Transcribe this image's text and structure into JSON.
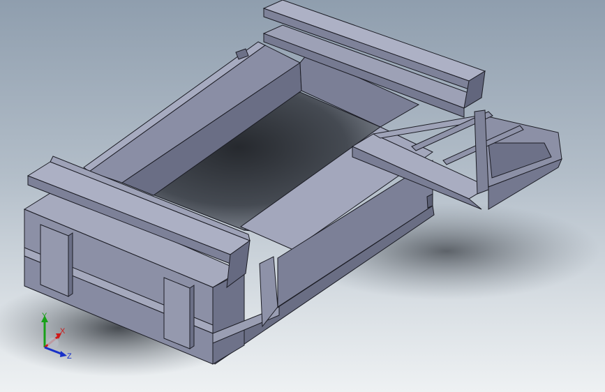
{
  "triad": {
    "x_label": "X",
    "y_label": "Y",
    "z_label": "Z",
    "x_color": "#d01818",
    "y_color": "#18a018",
    "z_color": "#1830c8"
  },
  "colors": {
    "bg_top": "#8f9eae",
    "bg_bottom": "#eef1f3",
    "steel_light": "#9a9eb4",
    "steel_mid": "#7f8399",
    "steel_dark": "#5d6076",
    "edge": "#1b1c24"
  }
}
